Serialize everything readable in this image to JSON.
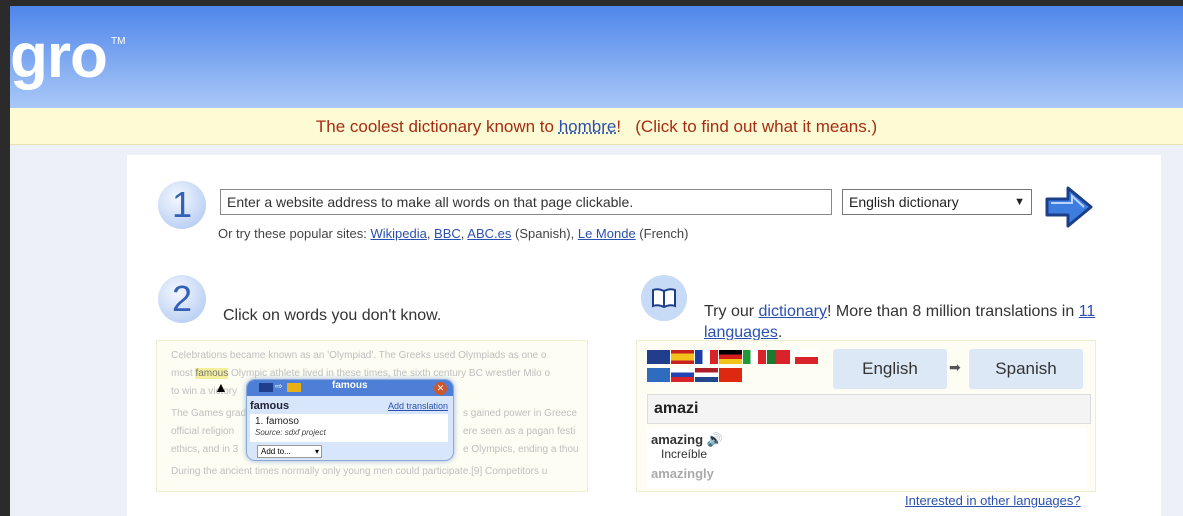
{
  "header": {
    "logo_text": "gro",
    "logo_tm": "TM"
  },
  "banner": {
    "text_before": "The coolest dictionary known to ",
    "link": "hombre",
    "text_after": "!   (Click to find out what it means.)"
  },
  "step1": {
    "number": "1",
    "url_placeholder": "Enter a website address to make all words on that page clickable.",
    "dictionary_select": "English dictionary",
    "popular_prefix": "Or try these popular sites: ",
    "sites": [
      "Wikipedia",
      "BBC",
      "ABC.es",
      "Le Monde"
    ],
    "abc_note": " (Spanish), ",
    "monde_note": " (French)"
  },
  "step2": {
    "number": "2",
    "instruction": "Click on words you don't know.",
    "demo_lines": [
      "Celebrations became known as an 'Olympiad'. The Greeks used Olympiads as one o",
      "most ",
      " Olympic athlete lived in these times, the sixth century BC wrestler Milo o",
      "to win a victory",
      "The Games grad",
      "official religion",
      "ethics, and in 3",
      "During the ancient times normally only young men could participate.[9] Competitors u"
    ],
    "demo_right_lines": [
      "s gained power in Greece",
      "ere seen as a pagan festi",
      "e Olympics, ending a thou"
    ],
    "demo_highlight": "famous",
    "popup": {
      "word": "famous",
      "title": "famous",
      "add_translation": "Add translation",
      "definition": "1. famoso",
      "source": "Source: sdxf project",
      "add_to": "Add to..."
    }
  },
  "dictionary": {
    "try_text": "Try our ",
    "link": "dictionary",
    "text2": "! More than 8 million translations in ",
    "languages_link": "11 languages",
    "end": ".",
    "from_lang": "English",
    "to_lang": "Spanish",
    "input_value": "amazi",
    "result_word": "amazing",
    "result_translation": "Increíble",
    "result_next": "amazingly",
    "other_languages": "Interested in other languages?"
  },
  "colors": {
    "header_top": "#4f86ea",
    "banner_text": "#a62c14",
    "link": "#2a50b0"
  }
}
